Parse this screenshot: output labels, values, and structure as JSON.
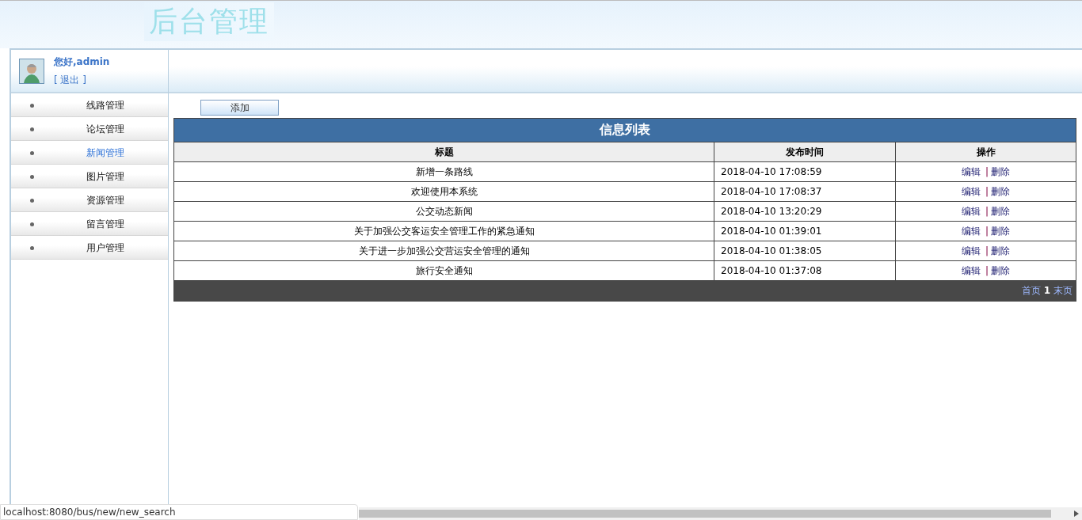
{
  "header": {
    "title": "后台管理"
  },
  "user": {
    "greeting": "您好,admin",
    "logout": "[ 退出 ]"
  },
  "sidebar": {
    "items": [
      {
        "label": "线路管理",
        "selected": false
      },
      {
        "label": "论坛管理",
        "selected": false
      },
      {
        "label": "新闻管理",
        "selected": true
      },
      {
        "label": "图片管理",
        "selected": false
      },
      {
        "label": "资源管理",
        "selected": false
      },
      {
        "label": "留言管理",
        "selected": false
      },
      {
        "label": "用户管理",
        "selected": false
      }
    ]
  },
  "add_button": "添加",
  "table": {
    "title": "信息列表",
    "columns": [
      "标题",
      "发布时间",
      "操作"
    ],
    "rows": [
      {
        "title": "新增一条路线",
        "time": "2018-04-10 17:08:59",
        "edit": "编辑",
        "separator": "|",
        "delete": "删除"
      },
      {
        "title": "欢迎使用本系统",
        "time": "2018-04-10 17:08:37",
        "edit": "编辑",
        "separator": "|",
        "delete": "删除"
      },
      {
        "title": "公交动态新闻",
        "time": "2018-04-10 13:20:29",
        "edit": "编辑",
        "separator": "|",
        "delete": "删除"
      },
      {
        "title": "关于加强公交客运安全管理工作的紧急通知",
        "time": "2018-04-10 01:39:01",
        "edit": "编辑",
        "separator": "|",
        "delete": "删除"
      },
      {
        "title": "关于进一步加强公交营运安全管理的通知",
        "time": "2018-04-10 01:38:05",
        "edit": "编辑",
        "separator": "|",
        "delete": "删除"
      },
      {
        "title": "旅行安全通知",
        "time": "2018-04-10 01:37:08",
        "edit": "编辑",
        "separator": "|",
        "delete": "删除"
      }
    ],
    "pager": {
      "first": "首页",
      "current": "1",
      "last": "末页"
    }
  },
  "status_bar": {
    "url": "localhost:8080/bus/new/new_search"
  }
}
